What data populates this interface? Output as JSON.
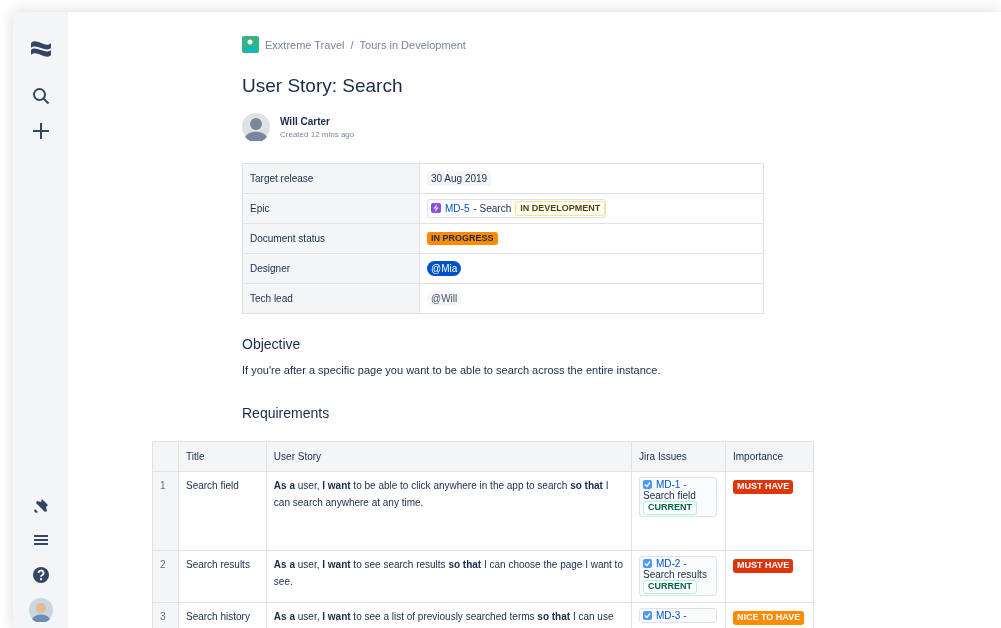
{
  "breadcrumbs": {
    "items": [
      "Exxtreme Travel",
      "Tours in Development"
    ],
    "separator": "/"
  },
  "title": "User Story: Search",
  "author": {
    "name": "Will Carter",
    "created": "Created 12 mins ago"
  },
  "properties": [
    {
      "label": "Target release",
      "value": {
        "kind": "date",
        "text": "30 Aug 2019"
      }
    },
    {
      "label": "Epic",
      "value": {
        "kind": "issue",
        "key": "MD-5",
        "summary": "- Search",
        "status": "IN DEVELOPMENT"
      }
    },
    {
      "label": "Document status",
      "value": {
        "kind": "status",
        "text": "IN PROGRESS",
        "color": "#ff8b00"
      }
    },
    {
      "label": "Designer",
      "value": {
        "kind": "mention",
        "text": "@Mia",
        "highlighted": true
      }
    },
    {
      "label": "Tech lead",
      "value": {
        "kind": "mention",
        "text": "@Will",
        "highlighted": false
      }
    }
  ],
  "objective": {
    "heading": "Objective",
    "text": "If you're after a specific page you want to be able to search across the entire instance."
  },
  "requirements": {
    "heading": "Requirements",
    "columns": [
      "Title",
      "User Story",
      "Jira Issues",
      "Importance"
    ],
    "rows": [
      {
        "number": "1",
        "title": "Search field",
        "story": "**As a** user, **I want** to be able to click anywhere in the app to search **so that** I can search anywhere at any time.",
        "issue": {
          "key": "MD-1 -",
          "summary": "Search field",
          "status": "CURRENT",
          "checked": true
        },
        "importance": {
          "text": "MUST HAVE",
          "color": "#de350b"
        }
      },
      {
        "number": "2",
        "title": "Search results",
        "story": "**As a** user, **I want** to see search results **so that** I can choose the page I want to see.",
        "issue": {
          "key": "MD-2 -",
          "summary": "Search results",
          "status": "CURRENT",
          "checked": true
        },
        "importance": {
          "text": "MUST HAVE",
          "color": "#de350b"
        }
      },
      {
        "number": "3",
        "title": "Search history",
        "story": "**As a** user, **I want** to see a list of previously searched terms **so that** I can use",
        "issue": {
          "key": "MD-3 -",
          "checked": true
        },
        "importance": {
          "text": "NICE TO HAVE",
          "color": "#ff8b00"
        }
      }
    ]
  }
}
